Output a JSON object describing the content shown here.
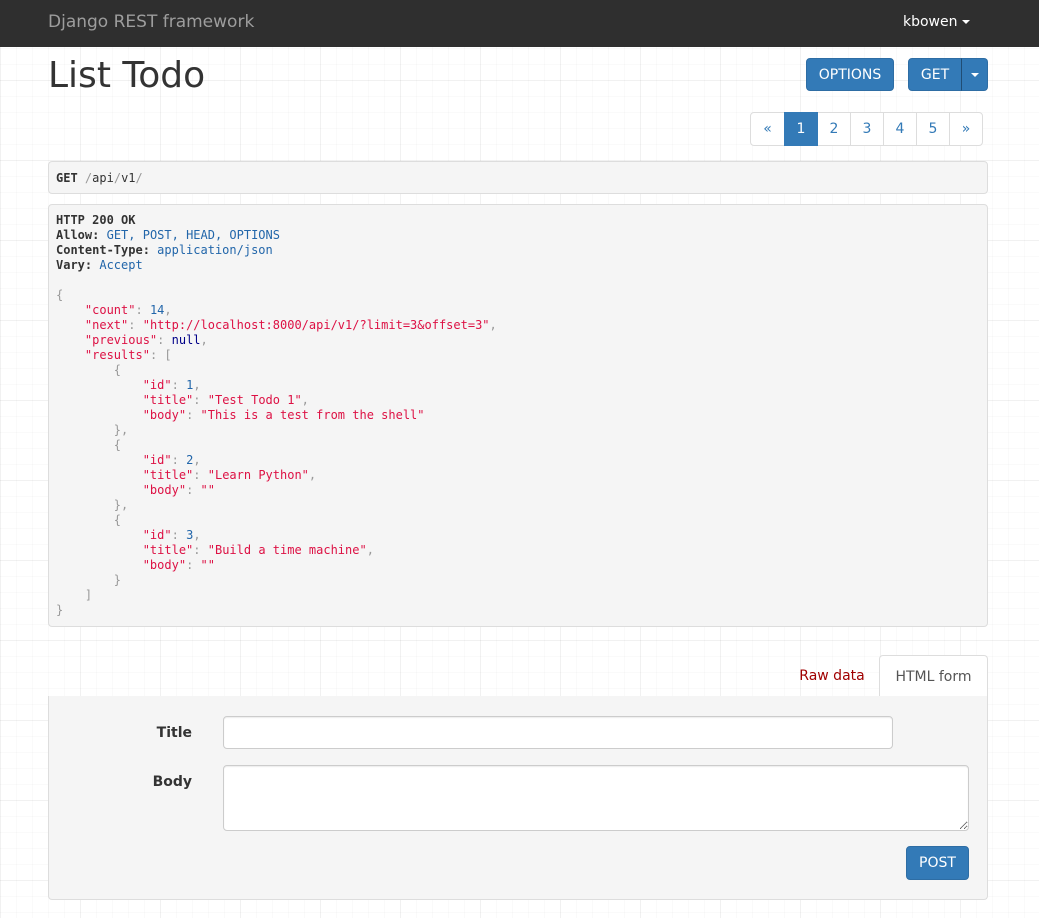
{
  "navbar": {
    "brand": "Django REST framework",
    "user": "kbowen"
  },
  "page": {
    "title": "List Todo"
  },
  "toolbar": {
    "options_label": "OPTIONS",
    "get_label": "GET"
  },
  "pagination": {
    "prev": "«",
    "pages": [
      "1",
      "2",
      "3",
      "4",
      "5"
    ],
    "next": "»",
    "active": "1"
  },
  "request": {
    "method": "GET",
    "path_parts": [
      "/",
      "api",
      "/",
      "v1",
      "/"
    ]
  },
  "response": {
    "status": "HTTP 200 OK",
    "headers": [
      {
        "name": "Allow:",
        "value": "GET, POST, HEAD, OPTIONS"
      },
      {
        "name": "Content-Type:",
        "value": "application/json"
      },
      {
        "name": "Vary:",
        "value": "Accept"
      }
    ],
    "json": {
      "count": 14,
      "next": "http://localhost:8000/api/v1/?limit=3&offset=3",
      "previous": null,
      "results": [
        {
          "id": 1,
          "title": "Test Todo 1",
          "body": "This is a test from the shell"
        },
        {
          "id": 2,
          "title": "Learn Python",
          "body": ""
        },
        {
          "id": 3,
          "title": "Build a time machine",
          "body": ""
        }
      ]
    }
  },
  "tabs": {
    "raw": "Raw data",
    "html": "HTML form"
  },
  "form": {
    "title_label": "Title",
    "body_label": "Body",
    "title_value": "",
    "body_value": "",
    "submit_label": "POST"
  },
  "colors": {
    "navbar": "#2f2f2f",
    "primary": "#337ab7",
    "string": "#dd1144",
    "number": "#2266aa",
    "raw_tab": "#a00000"
  }
}
